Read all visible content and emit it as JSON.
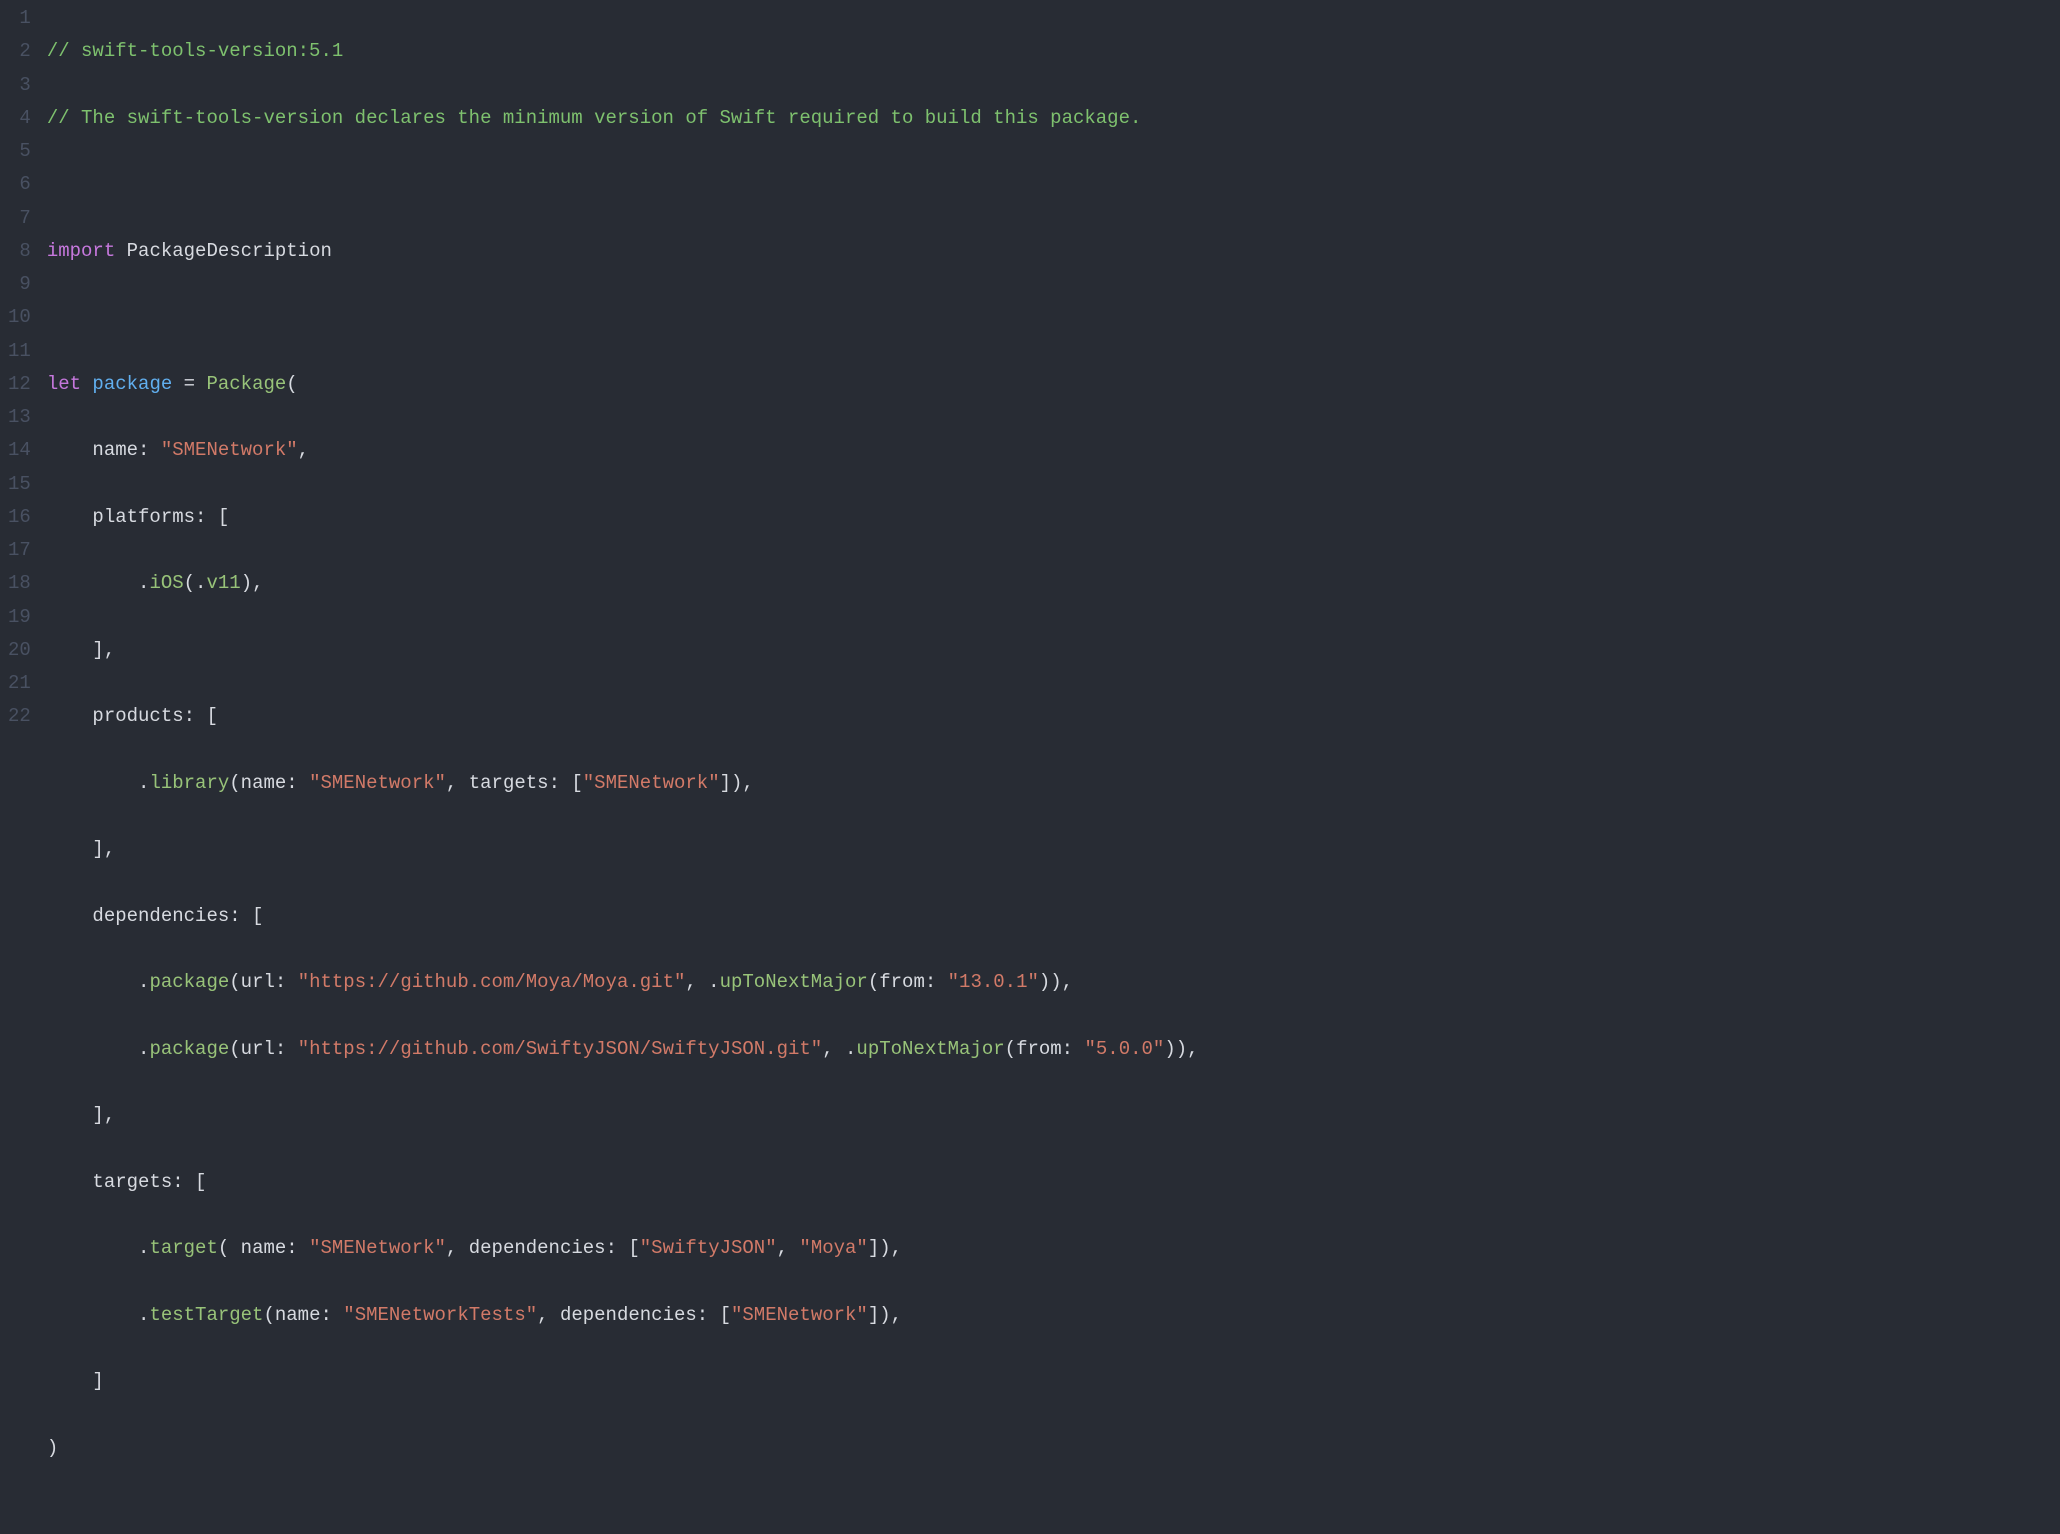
{
  "lines": {
    "ln1": "1",
    "ln2": "2",
    "ln3": "3",
    "ln4": "4",
    "ln5": "5",
    "ln6": "6",
    "ln7": "7",
    "ln8": "8",
    "ln9": "9",
    "ln10": "10",
    "ln11": "11",
    "ln12": "12",
    "ln13": "13",
    "ln14": "14",
    "ln15": "15",
    "ln16": "16",
    "ln17": "17",
    "ln18": "18",
    "ln19": "19",
    "ln20": "20",
    "ln21": "21",
    "ln22": "22"
  },
  "code": {
    "c1": "// swift-tools-version:5.1",
    "c2": "// The swift-tools-version declares the minimum version of Swift required to build this package.",
    "c4_import": "import",
    "c4_pkg": " PackageDescription",
    "c6_let": "let",
    "c6_package": " package",
    "c6_eq": " =",
    "c6_Package": " Package",
    "c6_open": "(",
    "c7_indent": "    ",
    "c7_name": "name",
    "c7_colon": ": ",
    "c7_str": "\"SMENetwork\"",
    "c7_comma": ",",
    "c8_indent": "    ",
    "c8_platforms": "platforms",
    "c8_rest": ": [",
    "c9_indent": "        .",
    "c9_ios": "iOS",
    "c9_open": "(.",
    "c9_v11": "v11",
    "c9_close": "),",
    "c10": "    ],",
    "c11_indent": "    ",
    "c11_products": "products",
    "c11_rest": ": [",
    "c12_indent": "        .",
    "c12_library": "library",
    "c12_open": "(",
    "c12_name": "name",
    "c12_colon1": ": ",
    "c12_str1": "\"SMENetwork\"",
    "c12_comma1": ", ",
    "c12_targets": "targets",
    "c12_colon2": ": [",
    "c12_str2": "\"SMENetwork\"",
    "c12_close": "]),",
    "c13": "    ],",
    "c14_indent": "    ",
    "c14_deps": "dependencies",
    "c14_rest": ": [",
    "c15_indent": "        .",
    "c15_package": "package",
    "c15_open": "(",
    "c15_url": "url",
    "c15_colon1": ": ",
    "c15_str1": "\"https://github.com/Moya/Moya.git\"",
    "c15_comma1": ", .",
    "c15_upTo": "upToNextMajor",
    "c15_open2": "(",
    "c15_from": "from",
    "c15_colon2": ": ",
    "c15_str2": "\"13.0.1\"",
    "c15_close": ")),",
    "c16_indent": "        .",
    "c16_package": "package",
    "c16_open": "(",
    "c16_url": "url",
    "c16_colon1": ": ",
    "c16_str1": "\"https://github.com/SwiftyJSON/SwiftyJSON.git\"",
    "c16_comma1": ", .",
    "c16_upTo": "upToNextMajor",
    "c16_open2": "(",
    "c16_from": "from",
    "c16_colon2": ": ",
    "c16_str2": "\"5.0.0\"",
    "c16_close": ")),",
    "c17": "    ],",
    "c18_indent": "    ",
    "c18_targets": "targets",
    "c18_rest": ": [",
    "c19_indent": "        .",
    "c19_target": "target",
    "c19_open": "( ",
    "c19_name": "name",
    "c19_colon1": ": ",
    "c19_str1": "\"SMENetwork\"",
    "c19_comma1": ", ",
    "c19_deps": "dependencies",
    "c19_colon2": ": [",
    "c19_str2": "\"SwiftyJSON\"",
    "c19_comma2": ", ",
    "c19_str3": "\"Moya\"",
    "c19_close": "]),",
    "c20_indent": "        .",
    "c20_testTarget": "testTarget",
    "c20_open": "(",
    "c20_name": "name",
    "c20_colon1": ": ",
    "c20_str1": "\"SMENetworkTests\"",
    "c20_comma1": ", ",
    "c20_deps": "dependencies",
    "c20_colon2": ": [",
    "c20_str2": "\"SMENetwork\"",
    "c20_close": "]),",
    "c21": "    ]",
    "c22": ")"
  }
}
